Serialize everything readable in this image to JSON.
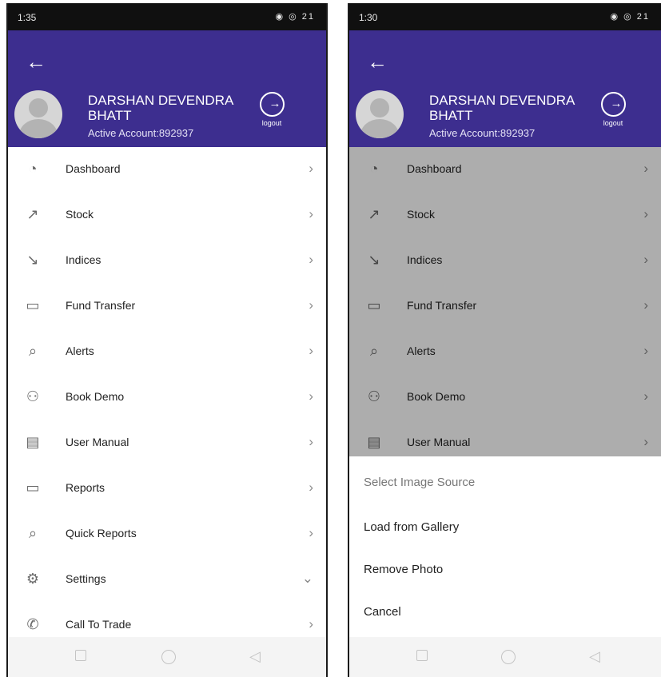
{
  "left": {
    "status": {
      "time": "1:35",
      "signal": "°▌l",
      "icons": "◉ ◎ 21"
    },
    "user": {
      "name": "DARSHAN DEVENDRA BHATT",
      "account": "Active Account:892937"
    },
    "logout_label": "logout",
    "menu": [
      {
        "label": "Dashboard",
        "icon": "gauge-icon",
        "glyph": "◔",
        "chev": "›"
      },
      {
        "label": "Stock",
        "icon": "stock-chart-icon",
        "glyph": "↗",
        "chev": "›"
      },
      {
        "label": "Indices",
        "icon": "indices-chart-icon",
        "glyph": "↘",
        "chev": "›"
      },
      {
        "label": "Fund Transfer",
        "icon": "wallet-icon",
        "glyph": "▭",
        "chev": "›"
      },
      {
        "label": "Alerts",
        "icon": "alert-search-icon",
        "glyph": "⌕",
        "chev": "›"
      },
      {
        "label": "Book Demo",
        "icon": "people-icon",
        "glyph": "⚇",
        "chev": "›"
      },
      {
        "label": "User Manual",
        "icon": "clipboard-icon",
        "glyph": "▤",
        "chev": "›"
      },
      {
        "label": "Reports",
        "icon": "reports-wallet-icon",
        "glyph": "▭",
        "chev": "›"
      },
      {
        "label": "Quick Reports",
        "icon": "quick-reports-icon",
        "glyph": "⌕",
        "chev": "›"
      },
      {
        "label": "Settings",
        "icon": "gear-icon",
        "glyph": "⚙",
        "chev": "⌄"
      },
      {
        "label": "Call To Trade",
        "icon": "phone-icon",
        "glyph": "✆",
        "chev": "›"
      }
    ]
  },
  "right": {
    "status": {
      "time": "1:30",
      "signal": "°▌l",
      "icons": "◉ ◎ 21"
    },
    "user": {
      "name": "DARSHAN DEVENDRA BHATT",
      "account": "Active Account:892937"
    },
    "logout_label": "logout",
    "menu": [
      {
        "label": "Dashboard",
        "icon": "gauge-icon",
        "glyph": "◔",
        "chev": "›"
      },
      {
        "label": "Stock",
        "icon": "stock-chart-icon",
        "glyph": "↗",
        "chev": "›"
      },
      {
        "label": "Indices",
        "icon": "indices-chart-icon",
        "glyph": "↘",
        "chev": "›"
      },
      {
        "label": "Fund Transfer",
        "icon": "wallet-icon",
        "glyph": "▭",
        "chev": "›"
      },
      {
        "label": "Alerts",
        "icon": "alert-search-icon",
        "glyph": "⌕",
        "chev": "›"
      },
      {
        "label": "Book Demo",
        "icon": "people-icon",
        "glyph": "⚇",
        "chev": "›"
      },
      {
        "label": "User Manual",
        "icon": "clipboard-icon",
        "glyph": "▤",
        "chev": "›"
      }
    ],
    "sheet": {
      "title": "Select Image Source",
      "options": [
        "Load from Gallery",
        "Remove Photo",
        "Cancel"
      ]
    }
  },
  "colors": {
    "header": "#3d2e8f",
    "overlay": "rgba(0,0,0,0.32)"
  },
  "nav_icons": [
    "recents-square-icon",
    "home-circle-icon",
    "back-triangle-icon"
  ]
}
